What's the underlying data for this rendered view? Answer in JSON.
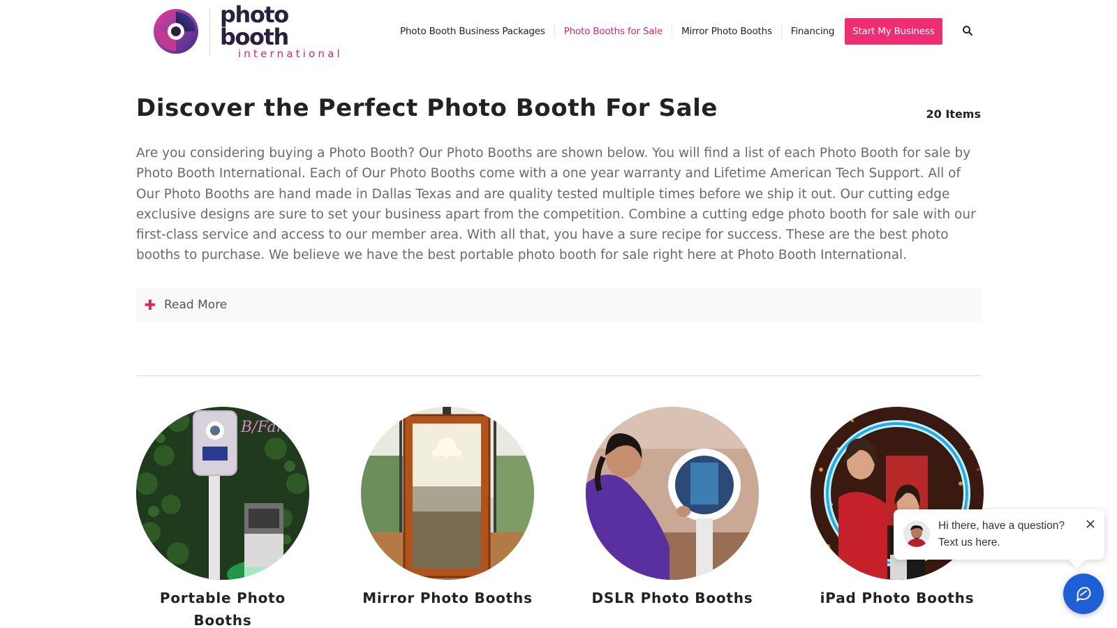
{
  "brand": {
    "name_main": "photo booth",
    "name_sub": "international",
    "colors": {
      "accent": "#ee2d72",
      "accent_text": "#d8246b",
      "navy": "#2a1f3d",
      "chat_blue": "#1f5fd6"
    }
  },
  "nav": {
    "items": [
      {
        "label": "Photo Booth Business Packages",
        "active": false
      },
      {
        "label": "Photo Booths for Sale",
        "active": true
      },
      {
        "label": "Mirror Photo Booths",
        "active": false
      },
      {
        "label": "Financing",
        "active": false
      }
    ],
    "cta_label": "Start My Business",
    "search_icon": "search-icon"
  },
  "main": {
    "title": "Discover the Perfect Photo Booth For Sale",
    "items_count": "20 Items",
    "intro": "Are you considering buying a Photo Booth? Our Photo Booths are shown below. You will find a list of each Photo Booth for sale by Photo Booth International.  Each of Our Photo Booths come with a one year warranty and Lifetime American Tech Support.  All of Our Photo Booths are hand made in Dallas Texas and are quality tested multiple times before we ship it out.  Our cutting edge exclusive designs are sure to set your business apart from the competition. Combine a cutting edge photo booth for sale with our first-class service and access to our member area. With all that, you have a sure recipe for success. These are the best photo booths to purchase.  We believe we have the best portable photo booth for sale right here at Photo Booth International.",
    "read_more_label": "Read More",
    "read_more_icon": "plus-icon"
  },
  "products": [
    {
      "name": "Portable Photo Booths"
    },
    {
      "name": "Mirror Photo Booths"
    },
    {
      "name": "DSLR Photo Booths"
    },
    {
      "name": "iPad Photo Booths"
    }
  ],
  "chat": {
    "line1": "Hi there, have a question?",
    "line2": "Text us here.",
    "close_icon": "close-icon",
    "button_icon": "chat-icon"
  }
}
